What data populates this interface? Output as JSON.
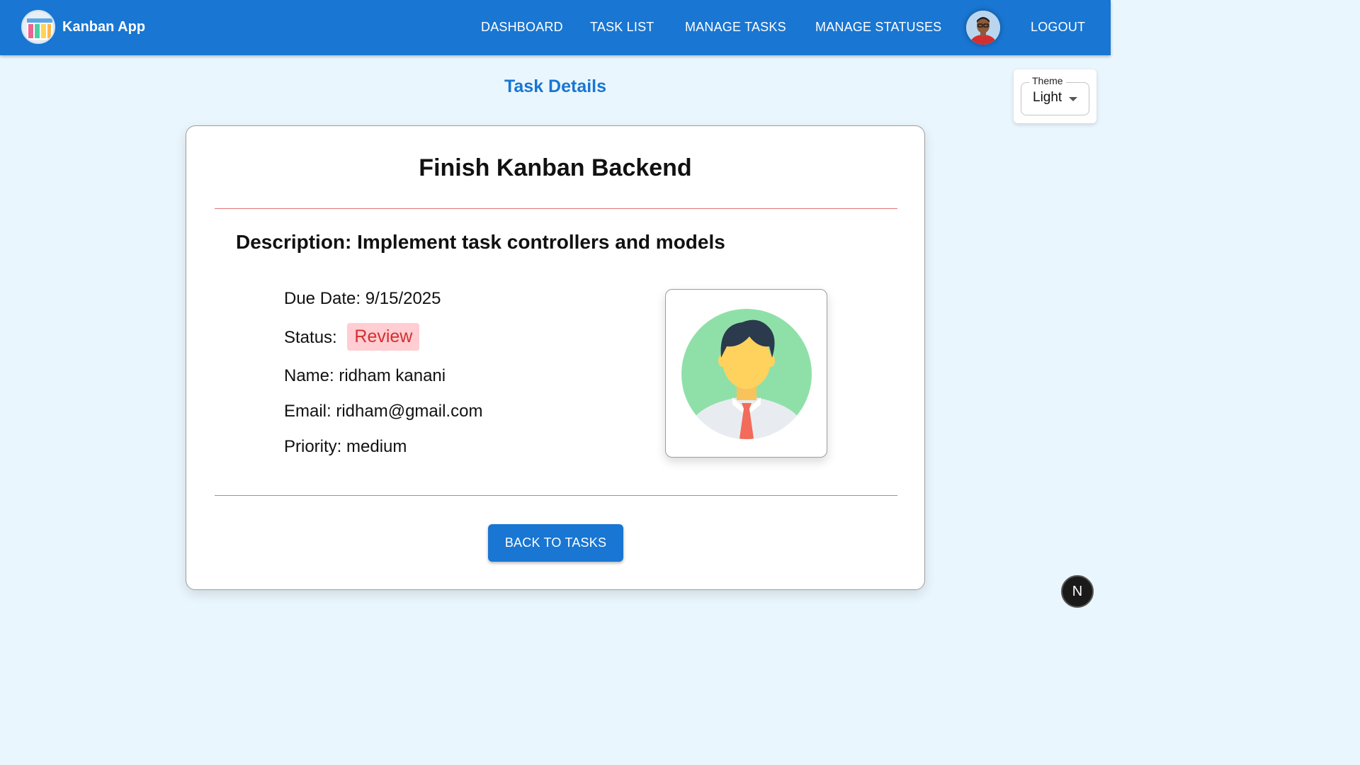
{
  "header": {
    "app_name": "Kanban App",
    "logo_icon": "kanban-board-icon",
    "nav": {
      "dashboard": "DASHBOARD",
      "task_list": "TASK LIST",
      "manage_tasks": "MANAGE TASKS",
      "manage_statuses": "MANAGE STATUSES",
      "logout": "LOGOUT"
    },
    "avatar_icon": "user-avatar-photo",
    "brand_color": "#1976d2"
  },
  "page": {
    "title": "Task Details"
  },
  "theme_select": {
    "label": "Theme",
    "value": "Light"
  },
  "task": {
    "title": "Finish Kanban Backend",
    "description_label": "Description:",
    "description": "Implement task controllers and models",
    "due_date_label": "Due Date:",
    "due_date": "9/15/2025",
    "status_label": "Status:",
    "status": "Review",
    "status_color": "#d32f2f",
    "name_label": "Name:",
    "name": "ridham kanani",
    "email_label": "Email:",
    "email": "ridham@gmail.com",
    "priority_label": "Priority:",
    "priority": "medium",
    "assignee_icon": "person-avatar-icon"
  },
  "actions": {
    "back_label": "BACK TO TASKS"
  },
  "dev_badge": {
    "letter": "N"
  }
}
